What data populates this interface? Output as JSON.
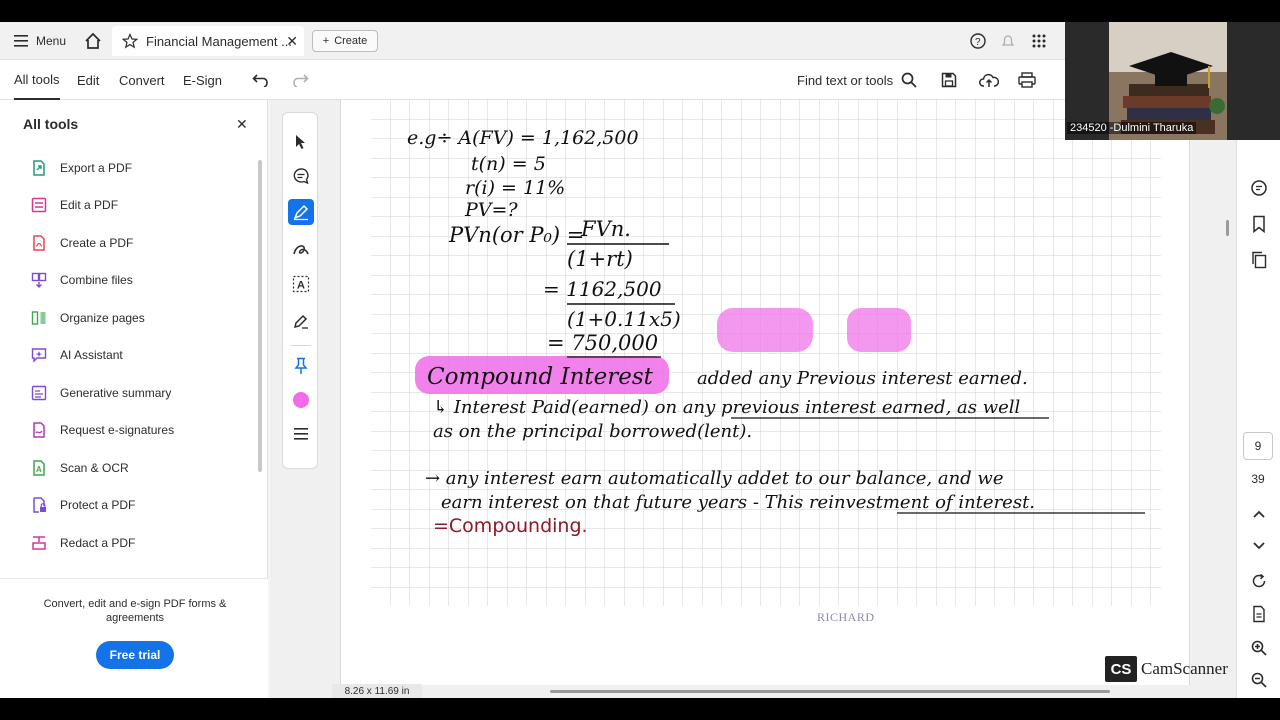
{
  "topbar": {
    "menu_label": "Menu",
    "tab_title": "Financial Management ...",
    "create_label": "Create"
  },
  "toolbar": {
    "tabs": [
      {
        "label": "All tools"
      },
      {
        "label": "Edit"
      },
      {
        "label": "Convert"
      },
      {
        "label": "E-Sign"
      }
    ],
    "find_label": "Find text or tools"
  },
  "left_panel": {
    "title": "All tools",
    "items": [
      {
        "label": "Export a PDF",
        "icon": "export-pdf-icon",
        "color": "#1f9e7a"
      },
      {
        "label": "Edit a PDF",
        "icon": "edit-pdf-icon",
        "color": "#d83790"
      },
      {
        "label": "Create a PDF",
        "icon": "create-pdf-icon",
        "color": "#e34850"
      },
      {
        "label": "Combine files",
        "icon": "combine-files-icon",
        "color": "#7e4bd8"
      },
      {
        "label": "Organize pages",
        "icon": "organize-pages-icon",
        "color": "#3da74e"
      },
      {
        "label": "AI Assistant",
        "icon": "ai-assistant-icon",
        "color": "#7e4bd8"
      },
      {
        "label": "Generative summary",
        "icon": "generative-summary-icon",
        "color": "#7e4bd8"
      },
      {
        "label": "Request e-signatures",
        "icon": "e-signature-icon",
        "color": "#b23ab2"
      },
      {
        "label": "Scan & OCR",
        "icon": "scan-ocr-icon",
        "color": "#3da74e"
      },
      {
        "label": "Protect a PDF",
        "icon": "protect-pdf-icon",
        "color": "#7e4bd8"
      },
      {
        "label": "Redact a PDF",
        "icon": "redact-pdf-icon",
        "color": "#d83790"
      }
    ],
    "footer_text": "Convert, edit and e-sign PDF forms & agreements",
    "free_trial_label": "Free trial"
  },
  "document": {
    "page_size": "8.26 x 11.69 in",
    "lines": {
      "eg": "e.g÷ A(FV) = 1,162,500",
      "t": "t(n) = 5",
      "r": "r(i) = 11%",
      "pv": "PV=?",
      "formula_lhs": "PVn(or P₀) =",
      "formula_num": "FVn.",
      "formula_den": "(1+rt)",
      "calc_num": "= 1162,500",
      "calc_den": "(1+0.11x5)",
      "result": "= 750,000",
      "heading": "Compound Interest",
      "heading_note": "added any Previous interest earned.",
      "def1": "↳ Interest Paid(earned) on any previous interest earned, as well",
      "def2": "as on the principal borrowed(lent).",
      "exp1": "→ any interest earn automatically addet to our balance, and we",
      "exp2": "earn interest on that future years - This reinvestment of interest.",
      "exp3": "=Compounding."
    },
    "scan_footer": "RICHARD",
    "watermark": "CamScanner",
    "watermark_logo": "CS",
    "highlight_color": "#f06ce8"
  },
  "right_rail": {
    "page_number": "9",
    "page_total": "39"
  },
  "video": {
    "label": "234520 -Dulmini Tharuka"
  }
}
